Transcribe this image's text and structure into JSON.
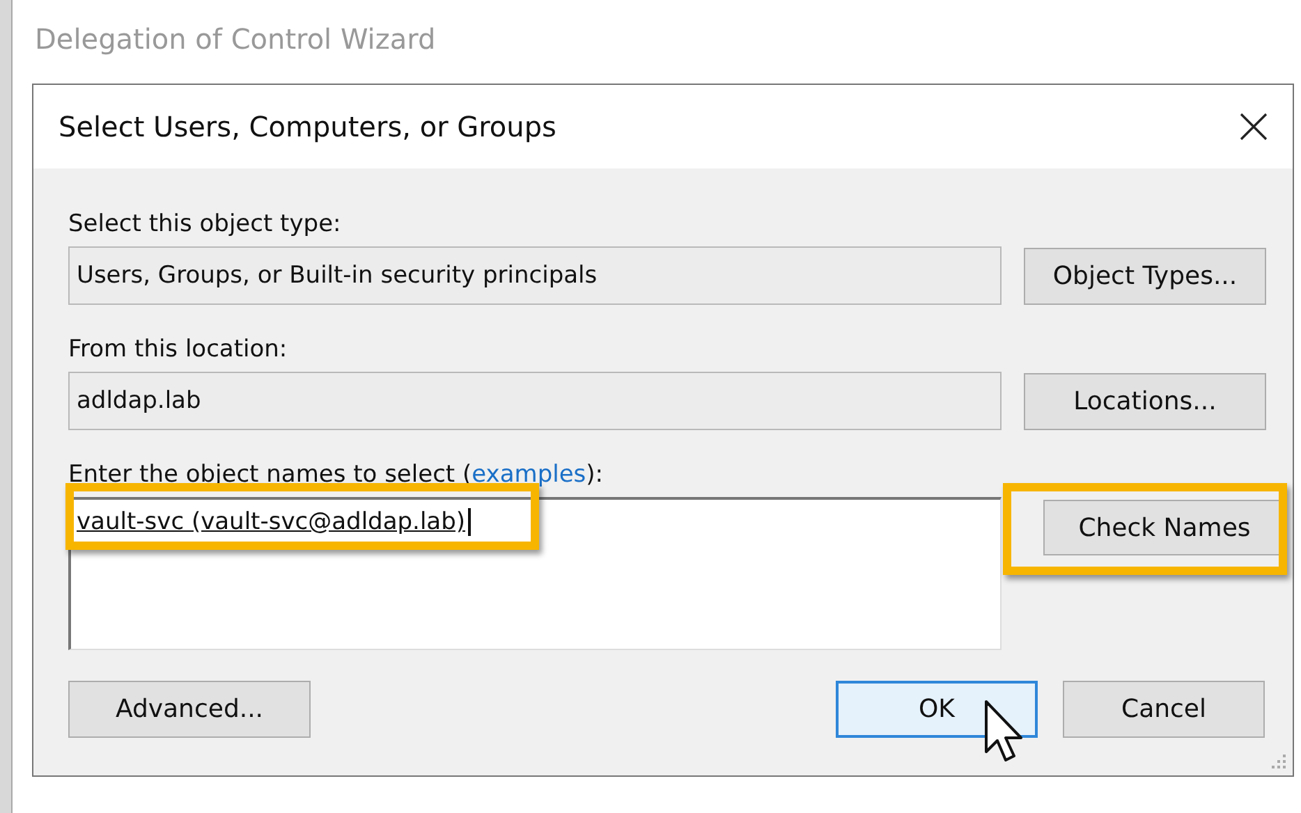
{
  "background_window": {
    "title": "Delegation of Control Wizard"
  },
  "dialog": {
    "title": "Select Users, Computers, or Groups",
    "object_type": {
      "label": "Select this object type:",
      "value": "Users, Groups, or Built-in security principals",
      "button": "Object Types..."
    },
    "location": {
      "label": "From this location:",
      "value": "adldap.lab",
      "button": "Locations..."
    },
    "object_names": {
      "label_before": "Enter the object names to select (",
      "link": "examples",
      "label_after": "):",
      "entries": [
        {
          "text": "vault-svc (vault-svc@adldap.lab)",
          "highlighted": true
        }
      ],
      "check_button": {
        "label": "Check Names",
        "highlighted": true
      }
    },
    "advanced_button": "Advanced...",
    "buttons": [
      {
        "label": "OK",
        "focused": true
      },
      {
        "label": "Cancel",
        "focused": false
      }
    ]
  }
}
